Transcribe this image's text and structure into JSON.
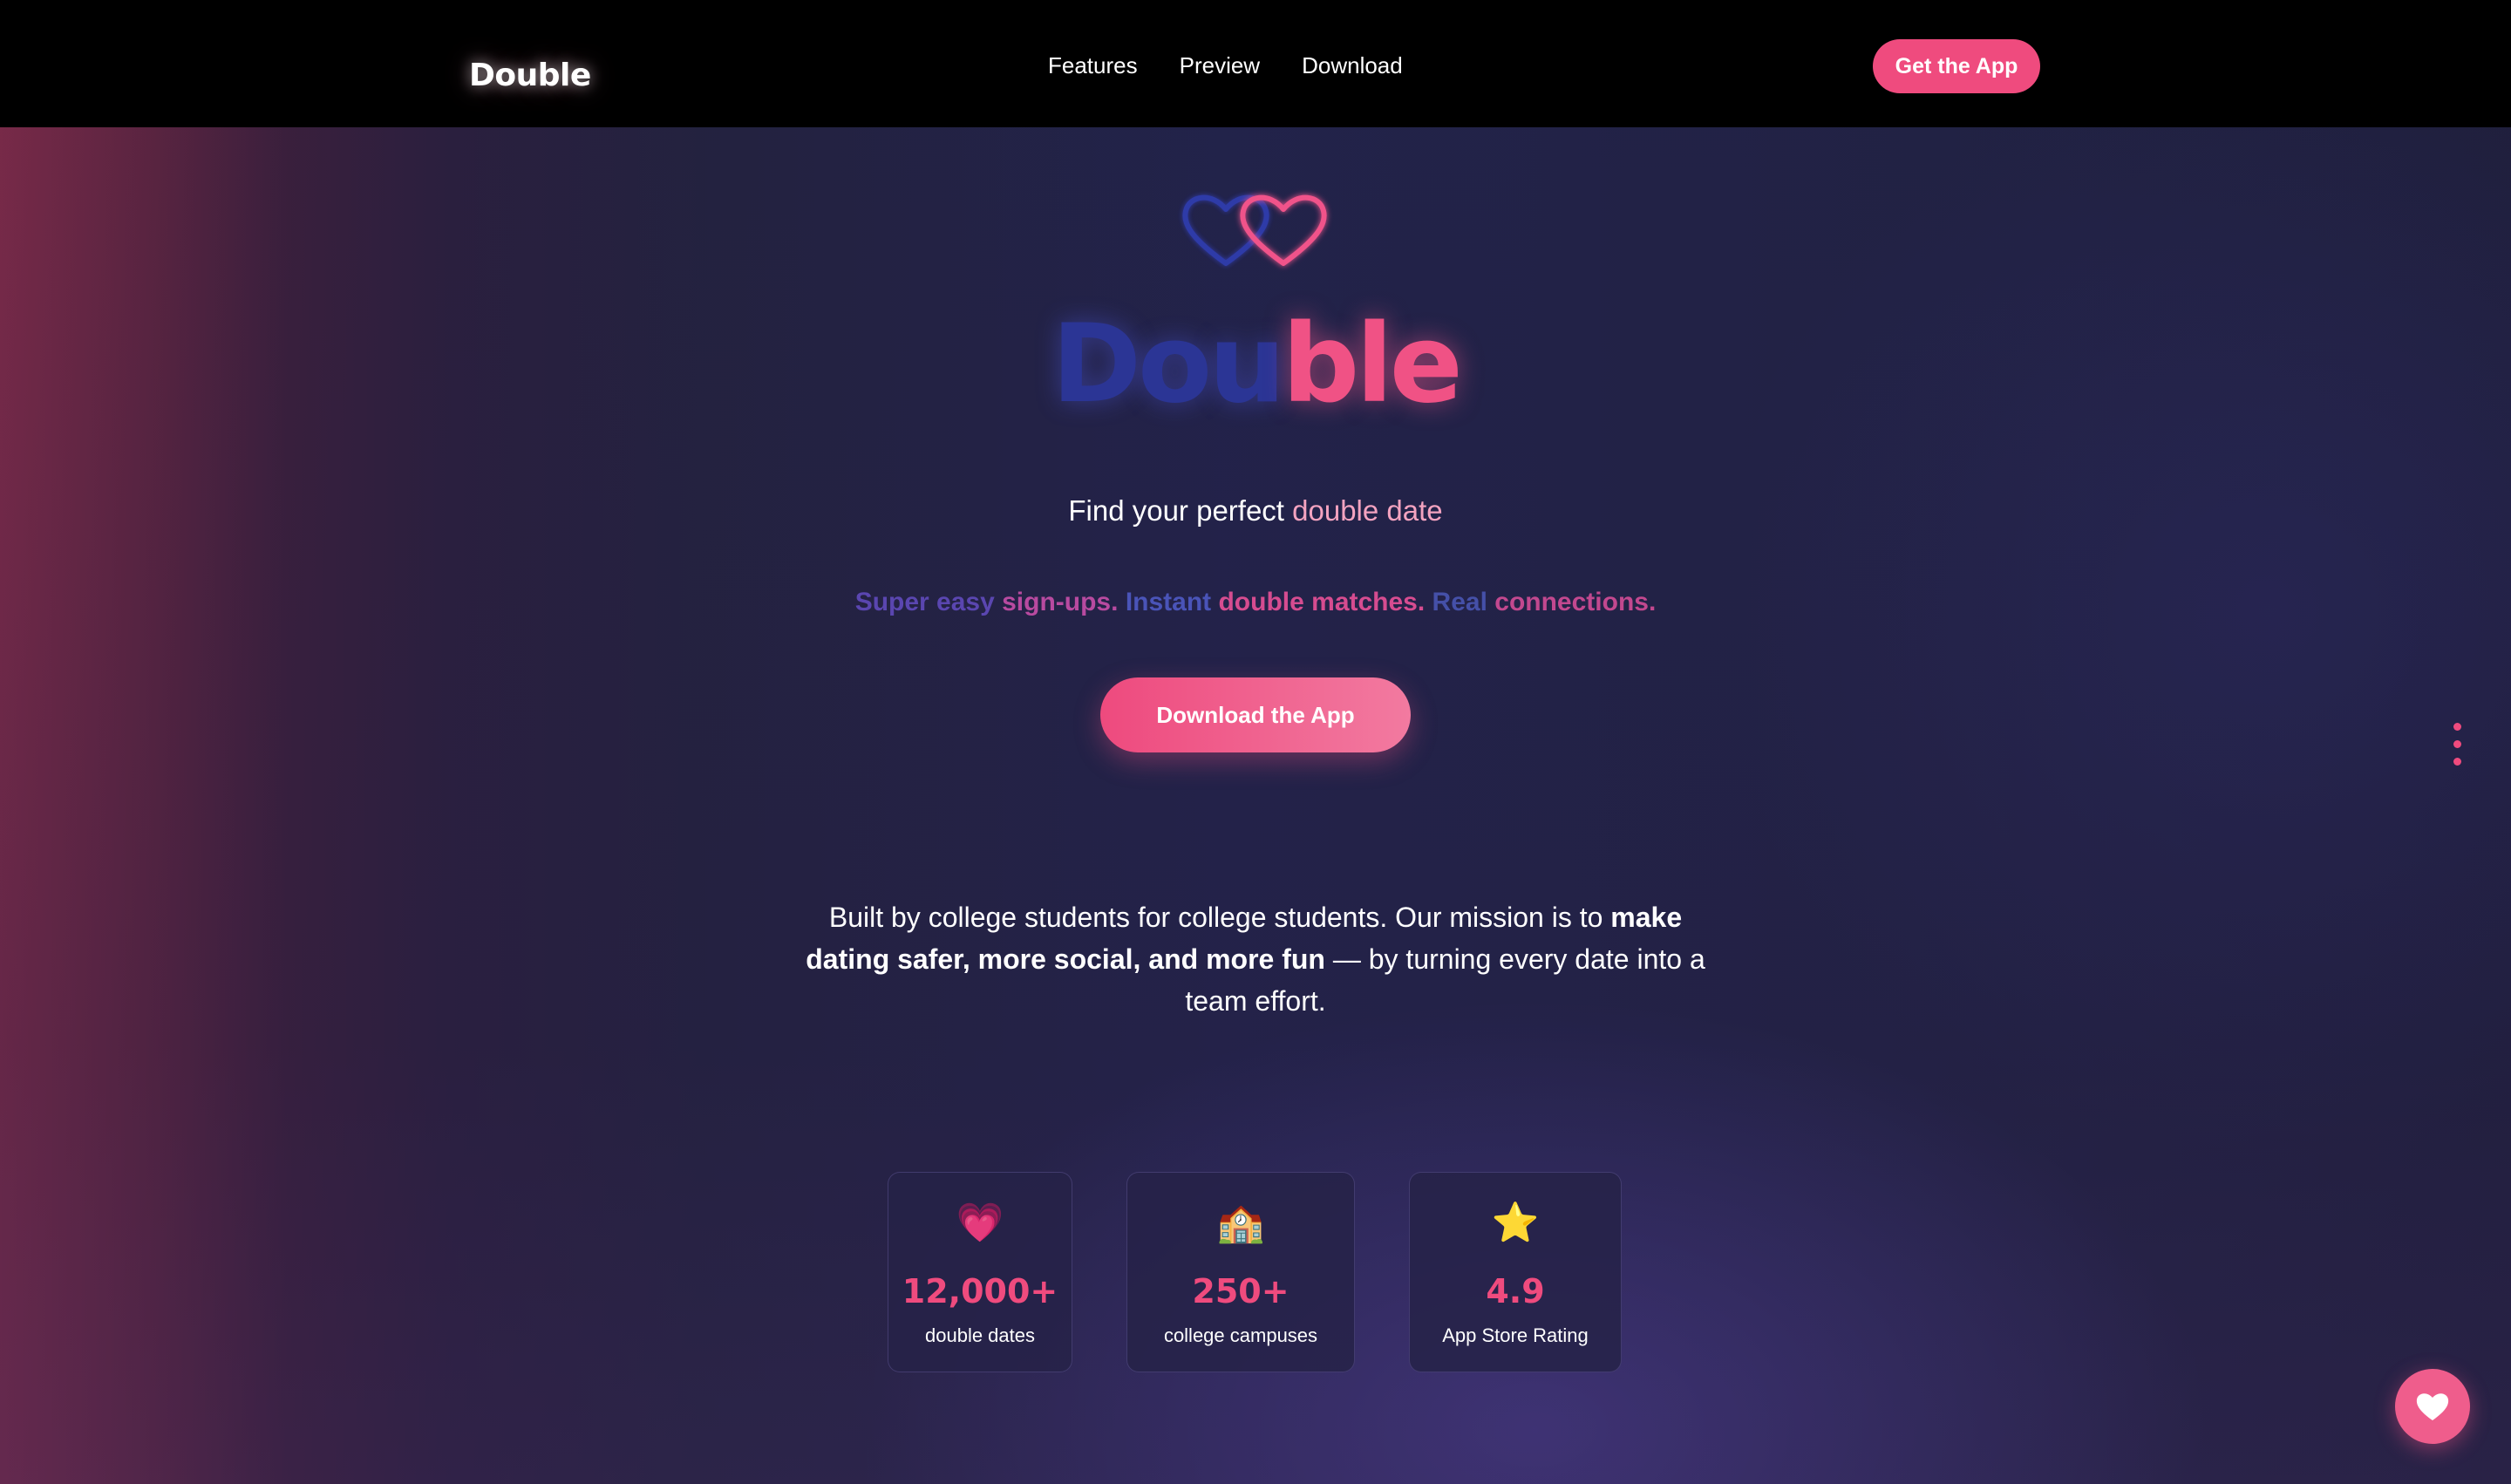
{
  "nav": {
    "brand": "Double",
    "links": [
      "Features",
      "Preview",
      "Download"
    ],
    "cta": "Get the App"
  },
  "hero": {
    "title_part1": "Dou",
    "title_part2": "ble",
    "tagline_prefix": "Find your perfect ",
    "tagline_highlight": "double date",
    "pitch": {
      "p1a": "Super easy ",
      "p1b": "sign-ups.",
      "p2a": "Instant ",
      "p2b": "double matches.",
      "p3a": "Real ",
      "p3b": "connections."
    },
    "button": "Download the App"
  },
  "mission": {
    "part1": "Built by college students for college students. Our mission is to ",
    "bold": "make dating safer, more social, and more fun",
    "part2": " — by turning every date into a team effort."
  },
  "stats": [
    {
      "icon": "💗",
      "value": "12,000+",
      "label": "double dates"
    },
    {
      "icon": "🏫",
      "value": "250+",
      "label": "college campuses"
    },
    {
      "icon": "⭐",
      "value": "4.9",
      "label": "App Store Rating"
    }
  ],
  "colors": {
    "accent": "#ef4b7e",
    "navy": "#2b3595",
    "nav_bg": "#000000"
  },
  "icons": {
    "hearts_logo": "double-hearts-icon",
    "menu": "vertical-dots-icon",
    "fab": "heart-icon"
  }
}
